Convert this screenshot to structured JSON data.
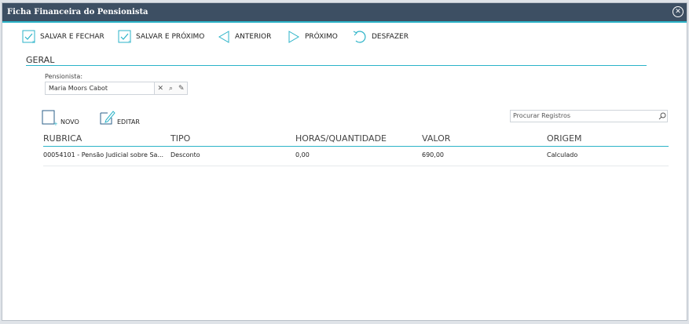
{
  "window": {
    "title": "Ficha Financeira do Pensionista"
  },
  "toolbar": {
    "save_close": "SALVAR E FECHAR",
    "save_next": "SALVAR E PRÓXIMO",
    "previous": "ANTERIOR",
    "next": "PRÓXIMO",
    "undo": "DESFAZER"
  },
  "section": {
    "title": "GERAL"
  },
  "pensioner": {
    "label": "Pensionista:",
    "value": "Maria Moors Cabot"
  },
  "list": {
    "new_label": "NOVO",
    "edit_label": "EDITAR",
    "search_placeholder": "Procurar Registros"
  },
  "table": {
    "headers": [
      "RUBRICA",
      "TIPO",
      "HORAS/QUANTIDADE",
      "VALOR",
      "ORIGEM"
    ],
    "rows": [
      [
        "00054101 - Pensão Judicial sobre Sa...",
        "Desconto",
        "0,00",
        "690,00",
        "Calculado"
      ]
    ]
  },
  "colors": {
    "titlebar": "#3d4f63",
    "accent": "#2bb3c8"
  },
  "icons": [
    "close-icon",
    "check-close-icon",
    "check-next-icon",
    "arrow-left-icon",
    "arrow-right-icon",
    "undo-icon",
    "clear-icon",
    "search-icon",
    "edit-icon",
    "new-icon"
  ]
}
